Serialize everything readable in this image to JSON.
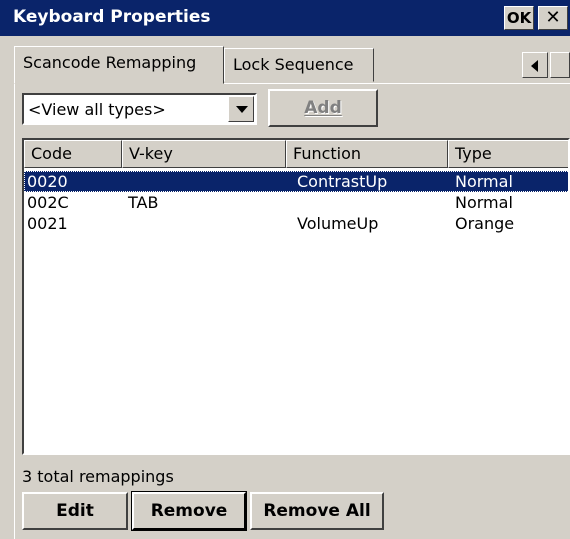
{
  "window": {
    "title": "Keyboard Properties",
    "ok_label": "OK",
    "close_label": "✕"
  },
  "tabs": [
    {
      "label": "Scancode Remapping",
      "active": true
    },
    {
      "label": "Lock Sequence",
      "active": false
    }
  ],
  "filter": {
    "selected": "<View all types>"
  },
  "toolbar": {
    "add_label": "Add",
    "add_enabled": false
  },
  "table": {
    "columns": [
      "Code",
      "V-key",
      "Function",
      "Type"
    ],
    "rows": [
      {
        "code": "0020",
        "vkey": "",
        "function": "ContrastUp",
        "type": "Normal",
        "selected": true
      },
      {
        "code": "002C",
        "vkey": "TAB",
        "function": "",
        "type": "Normal",
        "selected": false
      },
      {
        "code": "0021",
        "vkey": "",
        "function": "VolumeUp",
        "type": "Orange",
        "selected": false
      }
    ]
  },
  "status": {
    "text": "3 total remappings"
  },
  "buttons": {
    "edit_label": "Edit",
    "remove_label": "Remove",
    "remove_all_label": "Remove All"
  },
  "colors": {
    "titlebar": "#0a246a",
    "face": "#d4d0c8",
    "selection": "#0a246a"
  }
}
